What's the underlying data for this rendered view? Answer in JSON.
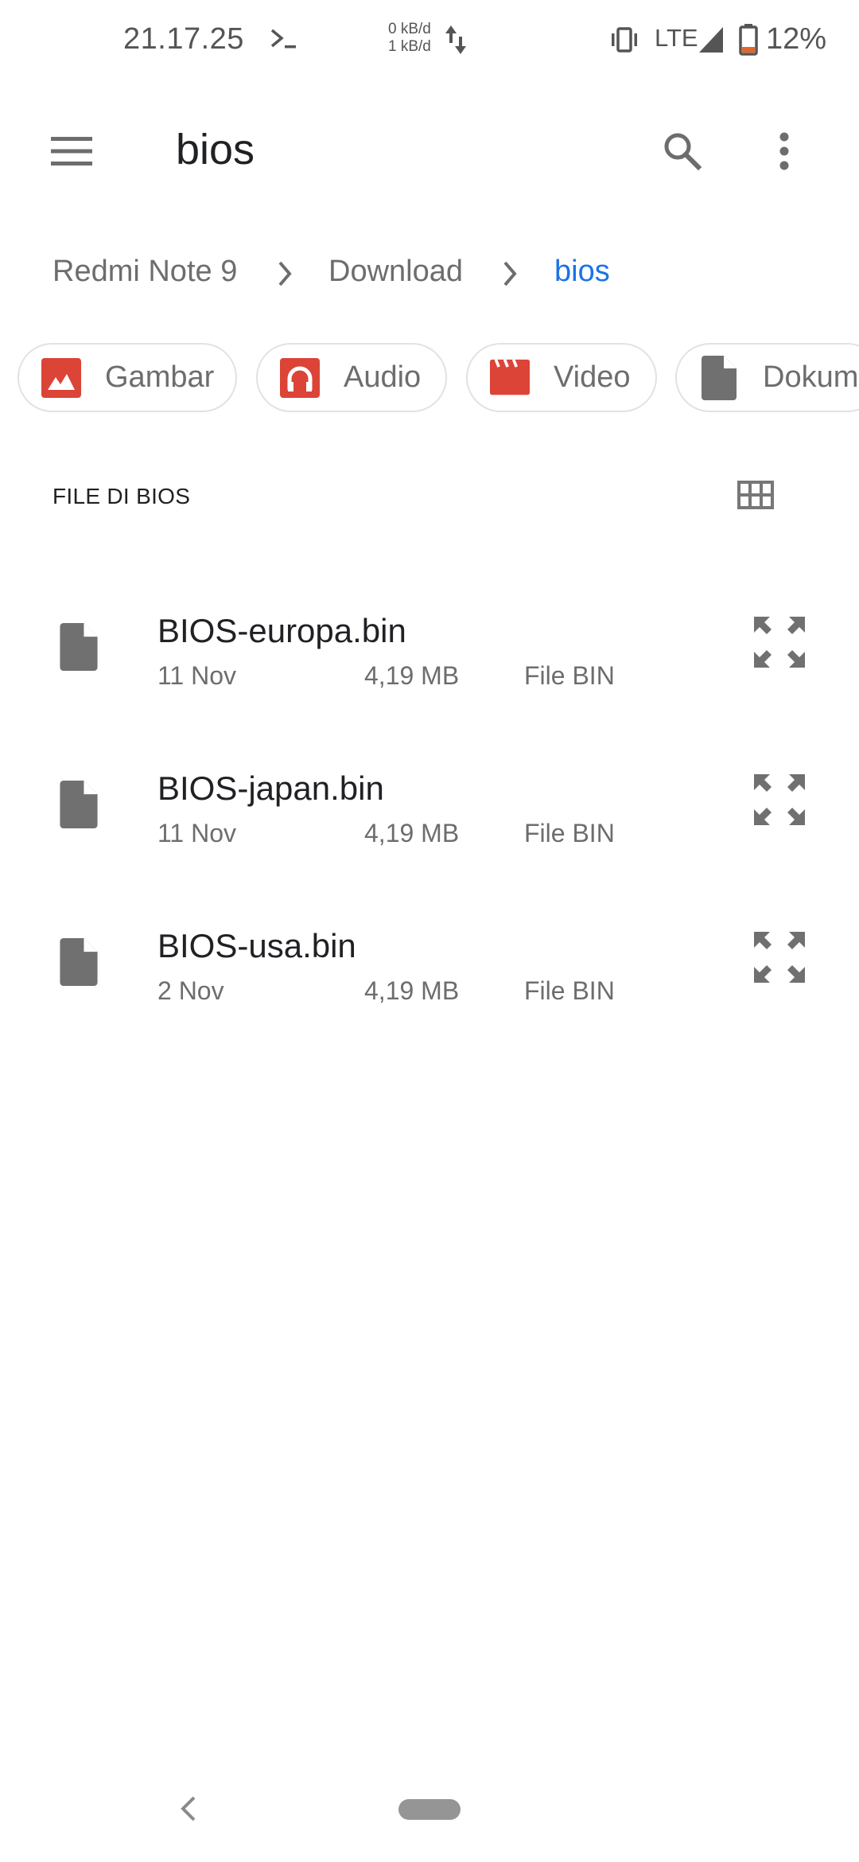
{
  "status_bar": {
    "time": "21.17.25",
    "terminal_icon": "terminal-icon",
    "net_up": "0 kB/d",
    "net_down": "1 kB/d",
    "network_type": "LTE",
    "battery_percent": "12%",
    "battery_level": 0.12,
    "icons": [
      "data-transfer-icon",
      "vibrate-icon",
      "signal-icon",
      "battery-icon"
    ]
  },
  "toolbar": {
    "title": "bios",
    "menu_icon": "hamburger-menu-icon",
    "search_icon": "search-icon",
    "more_icon": "more-vert-icon"
  },
  "breadcrumb": {
    "items": [
      {
        "label": "Redmi Note 9"
      },
      {
        "label": "Download"
      },
      {
        "label": "bios"
      }
    ],
    "active_color": "#1a73e8"
  },
  "categories": {
    "chips": [
      {
        "label": "Gambar",
        "icon": "image-icon",
        "color": "#db4437"
      },
      {
        "label": "Audio",
        "icon": "headphones-icon",
        "color": "#db4437"
      },
      {
        "label": "Video",
        "icon": "clapperboard-icon",
        "color": "#db4437"
      },
      {
        "label": "Dokum",
        "icon": "document-icon",
        "color": "#707070"
      }
    ]
  },
  "section": {
    "title": "FILE DI BIOS",
    "view_toggle_icon": "grid-view-icon"
  },
  "files": [
    {
      "name": "BIOS-europa.bin",
      "date": "11 Nov",
      "size": "4,19 MB",
      "type": "File BIN"
    },
    {
      "name": "BIOS-japan.bin",
      "date": "11 Nov",
      "size": "4,19 MB",
      "type": "File BIN"
    },
    {
      "name": "BIOS-usa.bin",
      "date": "2 Nov",
      "size": "4,19 MB",
      "type": "File BIN"
    }
  ],
  "nav_bar": {
    "back_icon": "back-chevron-icon",
    "home_icon": "home-pill-icon"
  }
}
